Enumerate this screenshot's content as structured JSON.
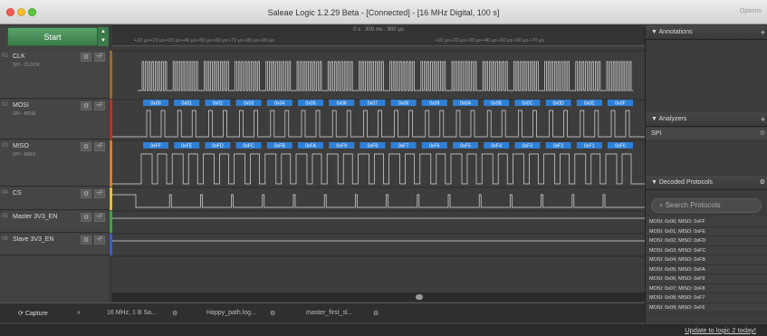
{
  "window": {
    "title": "Saleae Logic 1.2.29 Beta - [Connected] - [16 MHz Digital, 100 s]",
    "options": "Options"
  },
  "toolbar": {
    "start_label": "Start"
  },
  "ruler": {
    "time": "0 s : 309 ms : 900 µs",
    "ticks_left": [
      "+10 µs",
      "+20 µs",
      "+30 µs",
      "+40 µs",
      "+50 µs",
      "+60 µs",
      "+70 µs",
      "+80 µs",
      "+90 µs"
    ],
    "ticks_right": [
      "+10 µs",
      "+20 µs",
      "+30 µs",
      "+40 µs",
      "+50 µs",
      "+60 µs",
      "+70 µs"
    ]
  },
  "channels": [
    {
      "num": "01",
      "name": "CLK",
      "sub": "SPI - CLOCK",
      "color": "#9b6a2f"
    },
    {
      "num": "02",
      "name": "MOSI",
      "sub": "SPI - MOSI",
      "color": "#c0302b"
    },
    {
      "num": "03",
      "name": "MISO",
      "sub": "SPI - MISO",
      "color": "#e27a26"
    },
    {
      "num": "04",
      "name": "CS",
      "sub": "",
      "color": "#e3c231"
    },
    {
      "num": "05",
      "name": "Master 3V3_EN",
      "sub": "",
      "color": "#3fa34a"
    },
    {
      "num": "06",
      "name": "Slave 3V3_EN",
      "sub": "",
      "color": "#3a5fc8"
    }
  ],
  "mosi_bytes": [
    "0x00",
    "0x01",
    "0x02",
    "0x03",
    "0x04",
    "0x05",
    "0x06",
    "0x07",
    "0x08",
    "0x09",
    "0x0A",
    "0x0B",
    "0x0C",
    "0x0D",
    "0x0E",
    "0x0F"
  ],
  "miso_bytes": [
    "0xFF",
    "0xFE",
    "0xFD",
    "0xFC",
    "0xFB",
    "0xFA",
    "0xF9",
    "0xF8",
    "0xF7",
    "0xF6",
    "0xF5",
    "0xF4",
    "0xF3",
    "0xF2",
    "0xF1",
    "0xF0"
  ],
  "bottom": {
    "capture": "Capture",
    "rate": "16 MHz, 1 B Sa...",
    "tab1": "Happy_path.log...",
    "tab2": "master_first_sl..."
  },
  "right_panel": {
    "annotations": "Annotations",
    "analyzers": "Analyzers",
    "analyzer_item": "SPI",
    "decoded": "Decoded Protocols",
    "search_placeholder": "Search Protocols"
  },
  "decoded_rows": [
    "MOSI: 0x00;  MISO: 0xFF",
    "MOSI: 0x01;  MISO: 0xFE",
    "MOSI: 0x02;  MISO: 0xFD",
    "MOSI: 0x03;  MISO: 0xFC",
    "MOSI: 0x04;  MISO: 0xFB",
    "MOSI: 0x05;  MISO: 0xFA",
    "MOSI: 0x06;  MISO: 0xF9",
    "MOSI: 0x07;  MISO: 0xF8",
    "MOSI: 0x08;  MISO: 0xF7",
    "MOSI: 0x09;  MISO: 0xF6"
  ],
  "update": "Update to logic 2 today!"
}
